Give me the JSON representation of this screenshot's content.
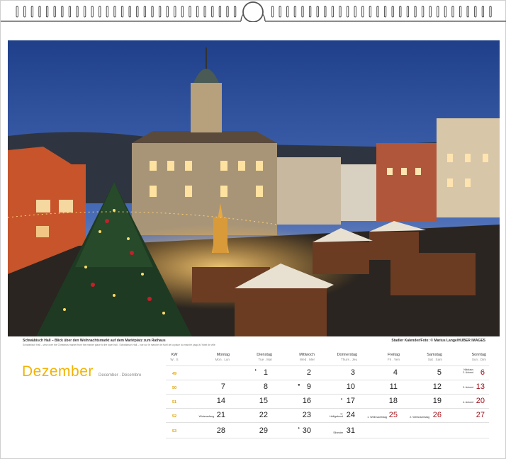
{
  "photo": {
    "caption": "Schwäbisch Hall – Blick über den Weihnachtsmarkt auf dem Marktplatz zum Rathaus",
    "subcaption": "Schwäbisch Hall – view over the Christmas market from the market place to the town hall . Schwäbisch Hall – vue sur le marché de Noël de la place du marché jusqu'à l'hôtel de ville",
    "credit": "Stadler Kalender/Foto: © Marius Lange/HUBER IMAGES"
  },
  "month": {
    "title": "Dezember",
    "subtitle": "December . Décembre"
  },
  "calendar": {
    "kw_header": {
      "d": "KW",
      "s": "W . S"
    },
    "days": [
      {
        "d": "Montag",
        "s": "Mon . Lun"
      },
      {
        "d": "Dienstag",
        "s": "Tue . Mar"
      },
      {
        "d": "Mittwoch",
        "s": "Wed . Mer"
      },
      {
        "d": "Donnerstag",
        "s": "Thurs . Jeu"
      },
      {
        "d": "Freitag",
        "s": "Fri . Ven"
      },
      {
        "d": "Samstag",
        "s": "Sat . Sam"
      },
      {
        "d": "Sonntag",
        "s": "Sun . Dim"
      }
    ],
    "weeks": [
      {
        "kw": "49",
        "cells": [
          "",
          "1",
          "2",
          "3",
          "4",
          "5",
          "6"
        ]
      },
      {
        "kw": "50",
        "cells": [
          "7",
          "8",
          "9",
          "10",
          "11",
          "12",
          "13"
        ]
      },
      {
        "kw": "51",
        "cells": [
          "14",
          "15",
          "16",
          "17",
          "18",
          "19",
          "20"
        ]
      },
      {
        "kw": "52",
        "cells": [
          "21",
          "22",
          "23",
          "24",
          "25",
          "26",
          "27"
        ]
      },
      {
        "kw": "53",
        "cells": [
          "28",
          "29",
          "30",
          "31",
          "",
          "",
          ""
        ]
      }
    ],
    "notes": {
      "nikolaus": "Nikolaus",
      "advent2": "2. Advent",
      "advent3": "3. Advent",
      "advent4": "4. Advent",
      "winteranfang": "Winteranfang",
      "heiligabend": "Heiligabend",
      "weihnacht1": "1. Weihnachtstag",
      "weihnacht2": "2. Weihnachtstag",
      "silvester": "Silvester"
    },
    "moons": {
      "w1": "◗",
      "w2": "●",
      "w3": "◖",
      "w5": "◗",
      "w4": "○"
    }
  },
  "colors": {
    "accent": "#f2b200",
    "sunday": "#a3141d"
  }
}
